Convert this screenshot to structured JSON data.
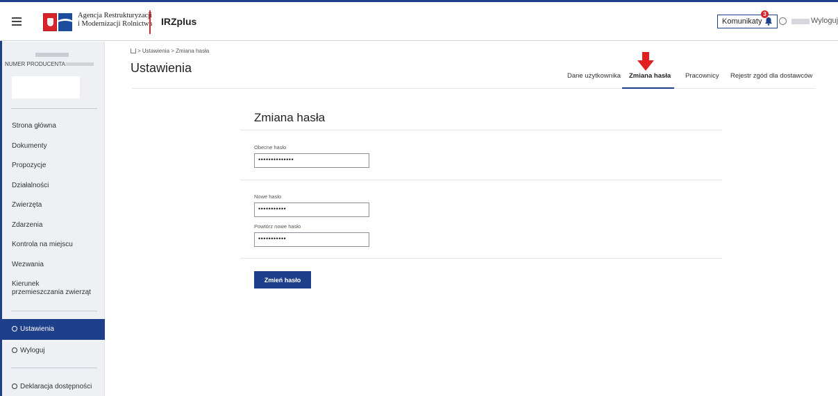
{
  "header": {
    "agency_line1": "Agencja Restrukturyzacji",
    "agency_line2": "i Modernizacji Rolnictwa",
    "app_name": "IRZplus",
    "komunikaty_label": "Komunikaty",
    "badge_count": "3",
    "logout_label": "Wyloguj"
  },
  "sidebar": {
    "producer_label": "NUMER PRODUCENTA:",
    "items": [
      {
        "label": "Strona główna"
      },
      {
        "label": "Dokumenty"
      },
      {
        "label": "Propozycje"
      },
      {
        "label": "Działalności"
      },
      {
        "label": "Zwierzęta"
      },
      {
        "label": "Zdarzenia"
      },
      {
        "label": "Kontrola na miejscu"
      },
      {
        "label": "Wezwania"
      },
      {
        "label": "Kierunek przemieszczania zwierząt"
      }
    ],
    "settings_label": "Ustawienia",
    "logout_label": "Wyloguj",
    "accessibility_label": "Deklaracja dostępności"
  },
  "main": {
    "breadcrumb": "> Ustawienia > Zmiana hasła",
    "title": "Ustawienia",
    "tabs": [
      {
        "label": "Dane użytkownika"
      },
      {
        "label": "Zmiana hasła"
      },
      {
        "label": "Pracownicy"
      },
      {
        "label": "Rejestr zgód dla dostawców"
      }
    ],
    "active_tab": "Zmiana hasła"
  },
  "form": {
    "title": "Zmiana hasła",
    "current_label": "Obecne hasło",
    "current_value": "••••••••••••••",
    "new_label": "Nowe hasło",
    "new_value": "•••••••••••",
    "repeat_label": "Powtórz nowe hasło",
    "repeat_value": "•••••••••••",
    "submit_label": "Zmień hasło"
  },
  "colors": {
    "primary": "#1e3f8a",
    "accent_red": "#e02020"
  }
}
